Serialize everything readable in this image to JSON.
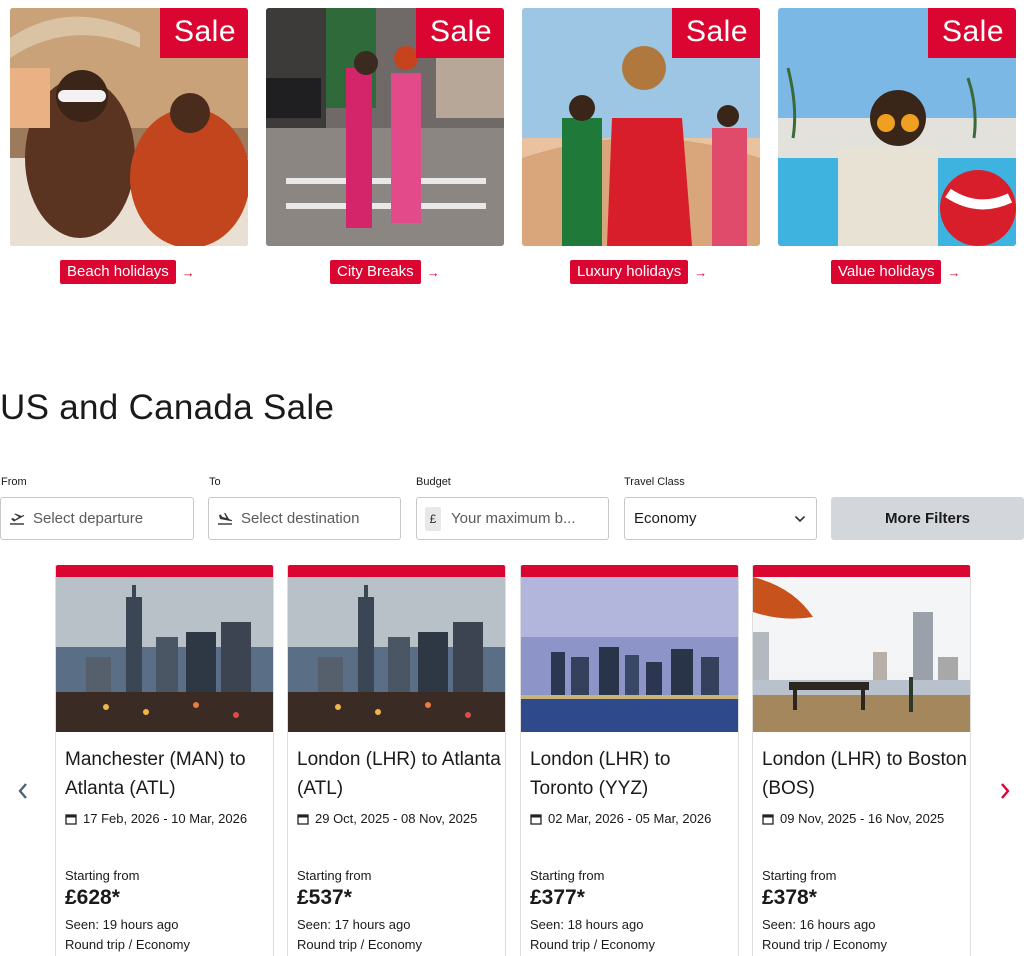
{
  "categories": [
    {
      "badge": "Sale",
      "label": "Beach holidays",
      "arrow": "→"
    },
    {
      "badge": "Sale",
      "label": "City Breaks",
      "arrow": "→"
    },
    {
      "badge": "Sale",
      "label": "Luxury holidays",
      "arrow": "→"
    },
    {
      "badge": "Sale",
      "label": "Value holidays",
      "arrow": "→"
    }
  ],
  "section": {
    "title": "US and Canada Sale"
  },
  "filters": {
    "from": {
      "label": "From",
      "placeholder": "Select departure",
      "icon": "departure-plane-icon"
    },
    "to": {
      "label": "To",
      "placeholder": "Select destination",
      "icon": "arrival-plane-icon"
    },
    "budget": {
      "label": "Budget",
      "currency": "£",
      "placeholder": "Your maximum b..."
    },
    "travel_class": {
      "label": "Travel Class",
      "value": "Economy",
      "icon": "chevron-down-icon"
    },
    "more_filters": "More Filters"
  },
  "deals": [
    {
      "route": "Manchester (MAN) to Atlanta (ATL)",
      "dates": "17 Feb, 2026 - 10 Mar, 2026",
      "from_label": "Starting from",
      "price": "£628*",
      "seen": "Seen: 19 hours ago",
      "trip": "Round trip / Economy"
    },
    {
      "route": "London (LHR) to Atlanta (ATL)",
      "dates": "29 Oct, 2025 - 08 Nov, 2025",
      "from_label": "Starting from",
      "price": "£537*",
      "seen": "Seen: 17 hours ago",
      "trip": "Round trip / Economy"
    },
    {
      "route": "London (LHR) to Toronto (YYZ)",
      "dates": "02 Mar, 2026 - 05 Mar, 2026",
      "from_label": "Starting from",
      "price": "£377*",
      "seen": "Seen: 18 hours ago",
      "trip": "Round trip / Economy"
    },
    {
      "route": "London (LHR) to Boston (BOS)",
      "dates": "09 Nov, 2025 - 16 Nov, 2025",
      "from_label": "Starting from",
      "price": "£378*",
      "seen": "Seen: 16 hours ago",
      "trip": "Round trip / Economy"
    }
  ],
  "colors": {
    "brand_red": "#da0530",
    "button_grey": "#d3d7dc"
  }
}
